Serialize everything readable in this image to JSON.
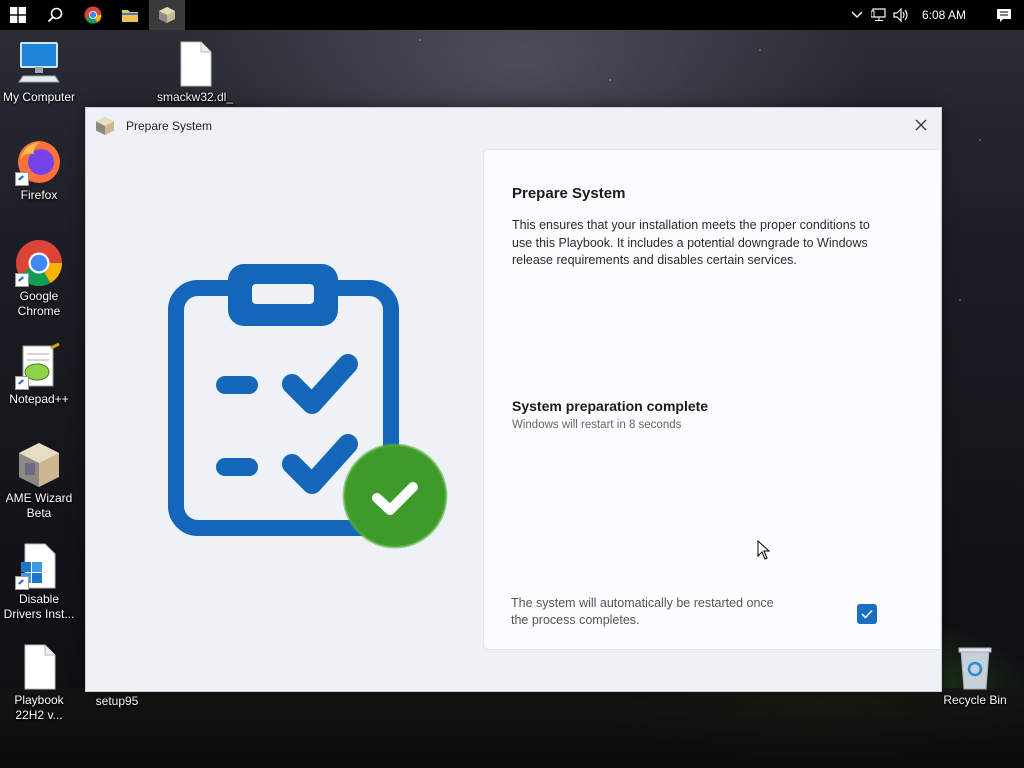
{
  "taskbar": {
    "buttons": [
      {
        "name": "start",
        "icon": "windows-logo-icon"
      },
      {
        "name": "search",
        "icon": "search-icon"
      },
      {
        "name": "chrome",
        "icon": "chrome-icon"
      },
      {
        "name": "explorer",
        "icon": "folder-icon"
      },
      {
        "name": "ame-wizard",
        "icon": "ame-box-icon",
        "active": true
      }
    ],
    "clock": "6:08 AM",
    "tray_icons": [
      "chevron-up-icon",
      "network-icon",
      "volume-icon"
    ],
    "notification_icon": "action-center-icon"
  },
  "desktop": {
    "icons": [
      {
        "label": "My Computer",
        "icon": "computer-icon"
      },
      {
        "label": "smackw32.dl_",
        "icon": "file-icon"
      },
      {
        "label": "Firefox",
        "icon": "firefox-icon"
      },
      {
        "label": "Google Chrome",
        "icon": "chrome-icon"
      },
      {
        "label": "Notepad++",
        "icon": "notepadpp-icon"
      },
      {
        "label": "AME Wizard Beta",
        "icon": "ame-box-icon"
      },
      {
        "label": "Disable Drivers Inst...",
        "icon": "script-icon"
      },
      {
        "label": "Playbook 22H2 v...",
        "icon": "file-icon"
      },
      {
        "label": "setup95",
        "icon": "file-icon"
      },
      {
        "label": "Recycle Bin",
        "icon": "recycle-bin-icon"
      }
    ]
  },
  "dialog": {
    "title": "Prepare System",
    "heading": "Prepare System",
    "description": "This ensures that your installation meets the proper conditions to use this Playbook. It includes a potential downgrade to Windows release requirements and disables certain services.",
    "status_title": "System preparation complete",
    "status_subtitle": "Windows will restart in 8 seconds",
    "restart_note": "The system will automatically be restarted once the process completes.",
    "auto_restart_checked": true
  },
  "colors": {
    "accent": "#1a6fc4",
    "success": "#3f9a2c",
    "clipboard": "#1467b8"
  }
}
